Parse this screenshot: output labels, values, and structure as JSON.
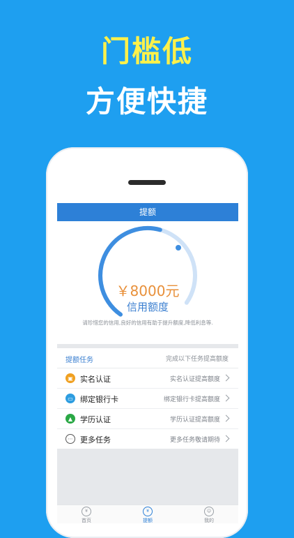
{
  "promo": {
    "headline1": "门槛低",
    "headline2": "方便快捷"
  },
  "app": {
    "title": "提额",
    "credit": {
      "amount": "￥8000元",
      "label": "信用额度",
      "note": "请珍惜您的信用,良好的信用有助于提升额度,降低利息等."
    },
    "tasks": {
      "title": "提额任务",
      "hint": "完成以下任务提高额度",
      "items": [
        {
          "label": "实名认证",
          "desc": "实名认证提高额度",
          "icon": "id-card-icon",
          "color": "#f0a020"
        },
        {
          "label": "绑定银行卡",
          "desc": "绑定银行卡提高额度",
          "icon": "bank-card-icon",
          "color": "#2d9de0"
        },
        {
          "label": "学历认证",
          "desc": "学历认证提高额度",
          "icon": "graduation-cap-icon",
          "color": "#2aa845"
        },
        {
          "label": "更多任务",
          "desc": "更多任务敬请期待",
          "icon": "more-dots-icon",
          "color": "#555555"
        }
      ]
    },
    "tabs": [
      {
        "label": "首页",
        "icon": "money-bag-icon"
      },
      {
        "label": "提额",
        "icon": "yen-icon"
      },
      {
        "label": "我的",
        "icon": "user-icon"
      }
    ]
  }
}
